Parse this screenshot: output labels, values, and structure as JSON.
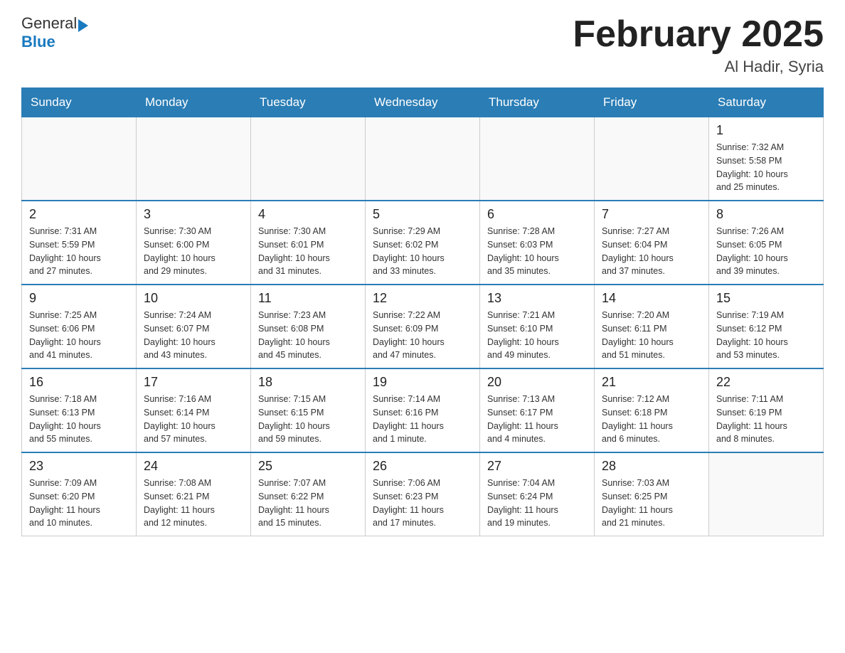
{
  "header": {
    "logo_general": "General",
    "logo_blue": "Blue",
    "month_title": "February 2025",
    "location": "Al Hadir, Syria"
  },
  "days_of_week": [
    "Sunday",
    "Monday",
    "Tuesday",
    "Wednesday",
    "Thursday",
    "Friday",
    "Saturday"
  ],
  "weeks": [
    [
      {
        "day": "",
        "info": ""
      },
      {
        "day": "",
        "info": ""
      },
      {
        "day": "",
        "info": ""
      },
      {
        "day": "",
        "info": ""
      },
      {
        "day": "",
        "info": ""
      },
      {
        "day": "",
        "info": ""
      },
      {
        "day": "1",
        "info": "Sunrise: 7:32 AM\nSunset: 5:58 PM\nDaylight: 10 hours\nand 25 minutes."
      }
    ],
    [
      {
        "day": "2",
        "info": "Sunrise: 7:31 AM\nSunset: 5:59 PM\nDaylight: 10 hours\nand 27 minutes."
      },
      {
        "day": "3",
        "info": "Sunrise: 7:30 AM\nSunset: 6:00 PM\nDaylight: 10 hours\nand 29 minutes."
      },
      {
        "day": "4",
        "info": "Sunrise: 7:30 AM\nSunset: 6:01 PM\nDaylight: 10 hours\nand 31 minutes."
      },
      {
        "day": "5",
        "info": "Sunrise: 7:29 AM\nSunset: 6:02 PM\nDaylight: 10 hours\nand 33 minutes."
      },
      {
        "day": "6",
        "info": "Sunrise: 7:28 AM\nSunset: 6:03 PM\nDaylight: 10 hours\nand 35 minutes."
      },
      {
        "day": "7",
        "info": "Sunrise: 7:27 AM\nSunset: 6:04 PM\nDaylight: 10 hours\nand 37 minutes."
      },
      {
        "day": "8",
        "info": "Sunrise: 7:26 AM\nSunset: 6:05 PM\nDaylight: 10 hours\nand 39 minutes."
      }
    ],
    [
      {
        "day": "9",
        "info": "Sunrise: 7:25 AM\nSunset: 6:06 PM\nDaylight: 10 hours\nand 41 minutes."
      },
      {
        "day": "10",
        "info": "Sunrise: 7:24 AM\nSunset: 6:07 PM\nDaylight: 10 hours\nand 43 minutes."
      },
      {
        "day": "11",
        "info": "Sunrise: 7:23 AM\nSunset: 6:08 PM\nDaylight: 10 hours\nand 45 minutes."
      },
      {
        "day": "12",
        "info": "Sunrise: 7:22 AM\nSunset: 6:09 PM\nDaylight: 10 hours\nand 47 minutes."
      },
      {
        "day": "13",
        "info": "Sunrise: 7:21 AM\nSunset: 6:10 PM\nDaylight: 10 hours\nand 49 minutes."
      },
      {
        "day": "14",
        "info": "Sunrise: 7:20 AM\nSunset: 6:11 PM\nDaylight: 10 hours\nand 51 minutes."
      },
      {
        "day": "15",
        "info": "Sunrise: 7:19 AM\nSunset: 6:12 PM\nDaylight: 10 hours\nand 53 minutes."
      }
    ],
    [
      {
        "day": "16",
        "info": "Sunrise: 7:18 AM\nSunset: 6:13 PM\nDaylight: 10 hours\nand 55 minutes."
      },
      {
        "day": "17",
        "info": "Sunrise: 7:16 AM\nSunset: 6:14 PM\nDaylight: 10 hours\nand 57 minutes."
      },
      {
        "day": "18",
        "info": "Sunrise: 7:15 AM\nSunset: 6:15 PM\nDaylight: 10 hours\nand 59 minutes."
      },
      {
        "day": "19",
        "info": "Sunrise: 7:14 AM\nSunset: 6:16 PM\nDaylight: 11 hours\nand 1 minute."
      },
      {
        "day": "20",
        "info": "Sunrise: 7:13 AM\nSunset: 6:17 PM\nDaylight: 11 hours\nand 4 minutes."
      },
      {
        "day": "21",
        "info": "Sunrise: 7:12 AM\nSunset: 6:18 PM\nDaylight: 11 hours\nand 6 minutes."
      },
      {
        "day": "22",
        "info": "Sunrise: 7:11 AM\nSunset: 6:19 PM\nDaylight: 11 hours\nand 8 minutes."
      }
    ],
    [
      {
        "day": "23",
        "info": "Sunrise: 7:09 AM\nSunset: 6:20 PM\nDaylight: 11 hours\nand 10 minutes."
      },
      {
        "day": "24",
        "info": "Sunrise: 7:08 AM\nSunset: 6:21 PM\nDaylight: 11 hours\nand 12 minutes."
      },
      {
        "day": "25",
        "info": "Sunrise: 7:07 AM\nSunset: 6:22 PM\nDaylight: 11 hours\nand 15 minutes."
      },
      {
        "day": "26",
        "info": "Sunrise: 7:06 AM\nSunset: 6:23 PM\nDaylight: 11 hours\nand 17 minutes."
      },
      {
        "day": "27",
        "info": "Sunrise: 7:04 AM\nSunset: 6:24 PM\nDaylight: 11 hours\nand 19 minutes."
      },
      {
        "day": "28",
        "info": "Sunrise: 7:03 AM\nSunset: 6:25 PM\nDaylight: 11 hours\nand 21 minutes."
      },
      {
        "day": "",
        "info": ""
      }
    ]
  ]
}
